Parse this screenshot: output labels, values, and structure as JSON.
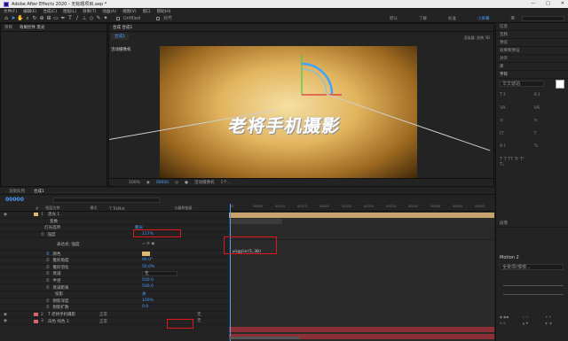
{
  "window": {
    "title": "Adobe After Effects 2020 - 无标题项目.aep *",
    "controls": [
      "—",
      "□",
      "✕"
    ]
  },
  "menu": [
    "文件(F)",
    "编辑(E)",
    "合成(C)",
    "图层(L)",
    "效果(T)",
    "动画(A)",
    "视图(V)",
    "窗口",
    "帮助(H)"
  ],
  "toolbar": {
    "snap_label": "Unfilled",
    "align_label": "对齐"
  },
  "workspaces": [
    "默认",
    "了解",
    "标准",
    "小屏幕",
    "库"
  ],
  "workspace_active": "小屏幕",
  "project_panel": {
    "tabs": [
      "项目",
      "效果控件 黑光"
    ]
  },
  "comp_panel": {
    "tab": "合成 合成1",
    "comp_tab": "合成1",
    "camera": "活动摄像机",
    "renderer_label": "渲染器: 经典 3D",
    "text": "老将手机摄影",
    "zoom": "100%",
    "timecode": "00000",
    "camera_select": "活动摄像机",
    "view_count": "1个..."
  },
  "right_panel": {
    "items": [
      "信息",
      "音频",
      "预览",
      "效果和预设",
      "对齐",
      "库"
    ],
    "char_label": "字符",
    "font_name": "华文琥珀",
    "paragraph_label": "段落",
    "motion_label": "Motion 2",
    "motion_dropdown": "全景项(慢慢...",
    "size_value": "1"
  },
  "timeline": {
    "tabs": [
      "渲染队列",
      "合成1"
    ],
    "time": "00000",
    "columns": [
      "#",
      "图层名称",
      "模式",
      "T TrkMat",
      "父级和链接"
    ],
    "rows": [
      {
        "num": "1",
        "name": "黑光 1",
        "color": "#e0b870",
        "mode": "",
        "parent": ""
      },
      {
        "num": "",
        "name": "变换",
        "color": "",
        "mode": "",
        "parent": ""
      },
      {
        "num": "",
        "name": "灯光选项",
        "color": "",
        "mode": "",
        "parent": ""
      },
      {
        "num": "",
        "name": "强度",
        "color": "",
        "mode": "",
        "parent": "117%"
      },
      {
        "num": "",
        "name": "表达式: 强度",
        "color": "",
        "mode": "",
        "parent": ""
      },
      {
        "num": "",
        "name": "颜色",
        "color": "",
        "mode": "",
        "parent": ""
      },
      {
        "num": "",
        "name": "锥形角度",
        "color": "",
        "mode": "",
        "parent": "90.0°"
      },
      {
        "num": "",
        "name": "锥形羽化",
        "color": "",
        "mode": "",
        "parent": "50.0%"
      },
      {
        "num": "",
        "name": "衰减",
        "color": "",
        "mode": "",
        "parent": "无"
      },
      {
        "num": "",
        "name": "半径",
        "color": "",
        "mode": "",
        "parent": "500.0"
      },
      {
        "num": "",
        "name": "衰减距离",
        "color": "",
        "mode": "",
        "parent": "500.0"
      },
      {
        "num": "",
        "name": "投影",
        "color": "",
        "mode": "",
        "parent": "关"
      },
      {
        "num": "",
        "name": "阴影深度",
        "color": "",
        "mode": "",
        "parent": "100%"
      },
      {
        "num": "",
        "name": "阴影扩散",
        "color": "",
        "mode": "",
        "parent": "0.0"
      },
      {
        "num": "2",
        "name": "T 老将手机摄影",
        "color": "#e0626a",
        "mode": "正常",
        "parent": "无"
      },
      {
        "num": "3",
        "name": "白色 纯色 1",
        "color": "#e0626a",
        "mode": "正常",
        "parent": "无"
      }
    ],
    "light_type": "聚光",
    "expression": "wiggle(5,30)",
    "ruler": [
      "0f",
      "00005",
      "00010",
      "00015",
      "00020",
      "00025",
      "00030",
      "00035",
      "00040",
      "00045",
      "00050",
      "00055"
    ]
  },
  "colors": {
    "accent": "#4a9cff",
    "highlight": "#e0161d",
    "layer_tan": "#c7a36e",
    "layer_red": "#8c2f37"
  }
}
